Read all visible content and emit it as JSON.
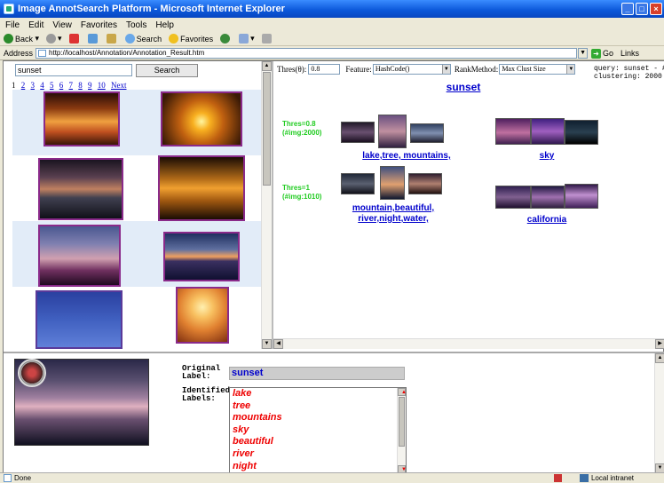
{
  "window": {
    "title": "Image AnnotSearch Platform - Microsoft Internet Explorer"
  },
  "menu": [
    "File",
    "Edit",
    "View",
    "Favorites",
    "Tools",
    "Help"
  ],
  "toolbar": {
    "back": "Back",
    "search": "Search",
    "favorites": "Favorites"
  },
  "address": {
    "label": "Address",
    "url": "http://localhost/Annotation/Annotation_Result.htm",
    "go": "Go",
    "links": "Links"
  },
  "search": {
    "query": "sunset",
    "button": "Search"
  },
  "pager": {
    "pages": [
      "1",
      "2",
      "3",
      "4",
      "5",
      "6",
      "7",
      "8",
      "9",
      "10"
    ],
    "next": "Next"
  },
  "controls": {
    "thres_label": "Thres(θ):",
    "thres_value": "0.8",
    "feature_label": "Feature:",
    "feature_value": "HashCode()",
    "rank_label": "RankMethod:",
    "rank_value": "Max Clust Size"
  },
  "query_info": {
    "line1": "query: sunset - #i",
    "line2": "clustering: 2000"
  },
  "query_title": "sunset",
  "clusters": {
    "t08_label": "Thres=0.8",
    "t08_sub": "(#img:2000)",
    "t1_label": "Thres=1",
    "t1_sub": "(#img:1010)",
    "c1": "lake,tree, mountains,",
    "c2": "sky",
    "c3_line1": "mountain,beautiful,",
    "c3_line2": "river,night,water,",
    "c4": "california"
  },
  "annotation": {
    "original_label_1": "Original",
    "original_label_2": "Label:",
    "original_value": "sunset",
    "identified_label_1": "Identified",
    "identified_label_2": "Labels:",
    "identified": [
      "lake",
      "tree",
      "mountains",
      "sky",
      "beautiful",
      "river",
      "night"
    ]
  },
  "status": {
    "left": "Done",
    "right": "Local intranet"
  }
}
